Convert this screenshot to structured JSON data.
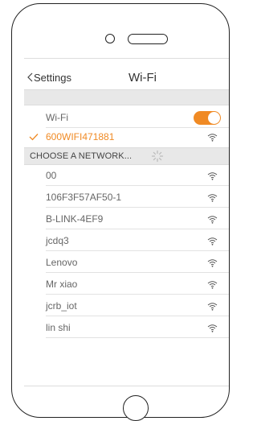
{
  "nav": {
    "back_label": "Settings",
    "title": "Wi-Fi"
  },
  "wifi_toggle": {
    "label": "Wi-Fi",
    "on": true
  },
  "connected_network": {
    "name": "600WIFI471881",
    "icon": "wifi-icon"
  },
  "section": {
    "label": "CHOOSE A NETWORK..."
  },
  "networks": [
    {
      "name": "00",
      "icon": "wifi-icon"
    },
    {
      "name": "106F3F57AF50-1",
      "icon": "wifi-icon"
    },
    {
      "name": "B-LINK-4EF9",
      "icon": "wifi-icon"
    },
    {
      "name": "jcdq3",
      "icon": "wifi-icon"
    },
    {
      "name": "Lenovo",
      "icon": "wifi-icon"
    },
    {
      "name": "Mr xiao",
      "icon": "wifi-icon"
    },
    {
      "name": "jcrb_iot",
      "icon": "wifi-icon"
    },
    {
      "name": "lin shi",
      "icon": "wifi-icon"
    }
  ],
  "colors": {
    "accent": "#f08a24",
    "section_bg": "#e8e8e8",
    "text": "#666666"
  }
}
